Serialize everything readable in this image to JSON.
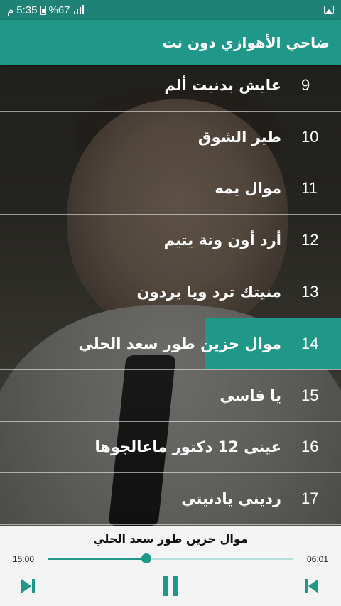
{
  "status_bar": {
    "time": "5:35",
    "am_pm": "م",
    "battery": "%67"
  },
  "app_bar": {
    "title": "ضاحي الأهوازي دون نت"
  },
  "songs": [
    {
      "number": "9",
      "title": "عايش بدنيت ألم"
    },
    {
      "number": "10",
      "title": "طير الشوق"
    },
    {
      "number": "11",
      "title": "موال يمه"
    },
    {
      "number": "12",
      "title": "أرد أون ونة يتيم"
    },
    {
      "number": "13",
      "title": "منيتك ترد ويا يردون"
    },
    {
      "number": "14",
      "title": "موال حزين طور سعد الحلي",
      "selected": true
    },
    {
      "number": "15",
      "title": "يا قاسي"
    },
    {
      "number": "16",
      "title": "عيني 12 دكتور ماعالجوها"
    },
    {
      "number": "17",
      "title": "رديني يادنيتي"
    }
  ],
  "player": {
    "now_playing": "موال حزين طور سعد الحلي",
    "total_time": "15:00",
    "elapsed_time": "06:01",
    "progress": 0.4
  },
  "colors": {
    "primary": "#1f9789",
    "status_bar": "#1e8277"
  }
}
